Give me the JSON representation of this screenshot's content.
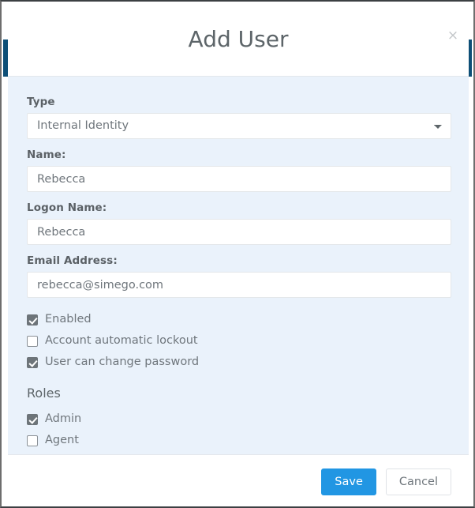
{
  "modal": {
    "title": "Add User",
    "close_icon": "close-icon",
    "close_glyph": "×"
  },
  "form": {
    "type": {
      "label": "Type",
      "value": "Internal Identity",
      "options": [
        "Internal Identity"
      ],
      "chevron_icon": "chevron-down-icon"
    },
    "name": {
      "label": "Name:",
      "value": "Rebecca",
      "placeholder": ""
    },
    "logon_name": {
      "label": "Logon Name:",
      "value": "Rebecca",
      "placeholder": ""
    },
    "email": {
      "label": "Email Address:",
      "value": "rebecca@simego.com",
      "placeholder": ""
    },
    "options": [
      {
        "label": "Enabled",
        "checked": true
      },
      {
        "label": "Account automatic lockout",
        "checked": false
      },
      {
        "label": "User can change password",
        "checked": true
      }
    ],
    "roles_heading": "Roles",
    "roles": [
      {
        "label": "Admin",
        "checked": true
      },
      {
        "label": "Agent",
        "checked": false
      }
    ]
  },
  "footer": {
    "save_label": "Save",
    "cancel_label": "Cancel"
  },
  "colors": {
    "accent": "#2196e3",
    "body_bg": "#eaf2fb",
    "page_bg": "#0d4f77",
    "text": "#6f767c",
    "label": "#5b6166"
  }
}
